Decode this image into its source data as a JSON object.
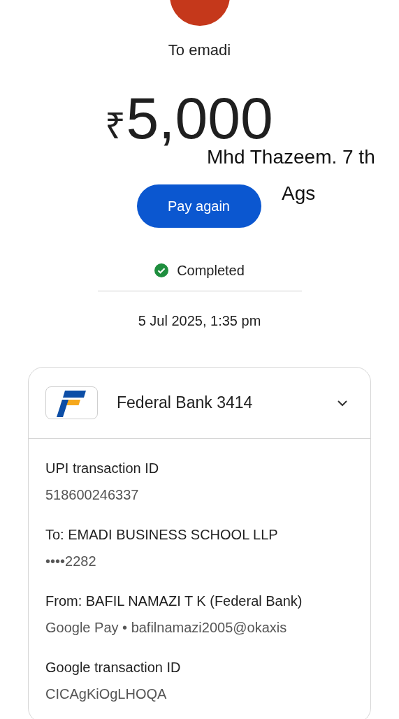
{
  "payee": {
    "title": "To emadi"
  },
  "payment": {
    "currency": "₹",
    "amount": "5,000"
  },
  "action": {
    "label": "Pay again"
  },
  "status": {
    "label": "Completed",
    "kind": "completed"
  },
  "timestamp": "5 Jul 2025, 1:35 pm",
  "annotations": [
    "Mhd Thazeem. 7 th",
    "Ags"
  ],
  "account_card": {
    "bank_name": "Federal Bank 3414",
    "expanded": true,
    "details": [
      {
        "label": "UPI transaction ID",
        "value": "518600246337"
      },
      {
        "label": "To: EMADI BUSINESS SCHOOL LLP",
        "value": "••••2282"
      },
      {
        "label": "From: BAFIL NAMAZI T K (Federal Bank)",
        "value": "Google Pay • bafilnamazi2005@okaxis"
      },
      {
        "label": "Google transaction ID",
        "value": "CICAgKiOgLHOQA"
      }
    ]
  }
}
